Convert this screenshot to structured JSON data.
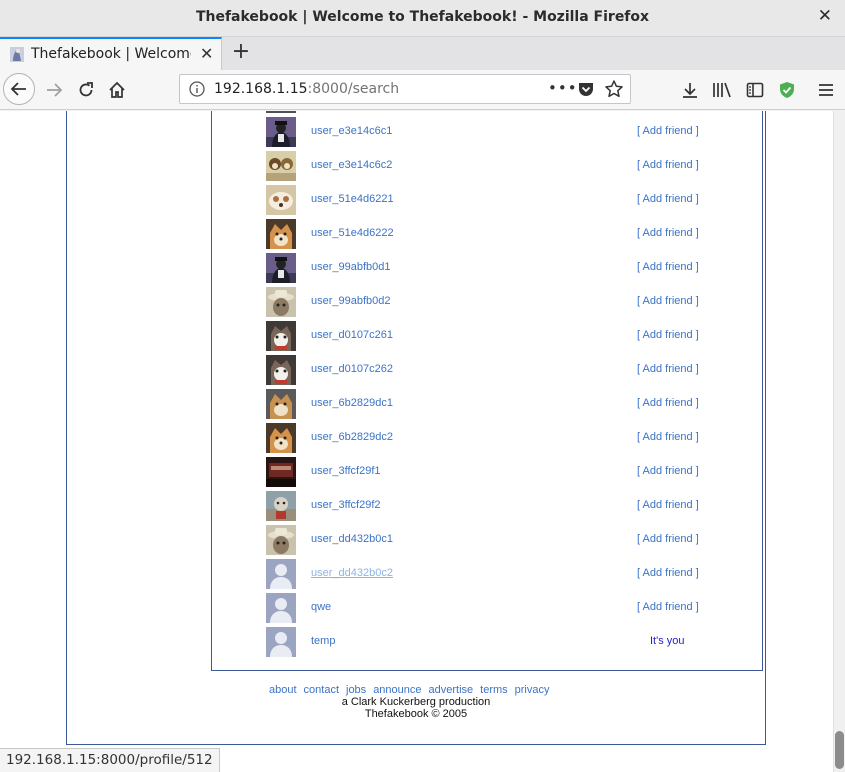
{
  "window": {
    "title": "Thefakebook | Welcome to Thefakebook! - Mozilla Firefox",
    "close_glyph": "✕"
  },
  "tab": {
    "title": "Thefakebook | Welcome to Thefakebook!",
    "close_glyph": "✕",
    "new_tab_glyph": "+"
  },
  "urlbar": {
    "host": "192.168.1.15",
    "path": ":8000/search",
    "more_glyph": "•••"
  },
  "colors": {
    "link": "#3b73c8",
    "frame_border": "#3b5998",
    "tab_accent": "#0a84ff",
    "self_label": "#1e1ed2",
    "shield": "#4caf50"
  },
  "results": [
    {
      "username": "user_e3e14c6c1",
      "action": "[ Add friend ]",
      "photo": "crow-hat"
    },
    {
      "username": "user_e3e14c6c2",
      "action": "[ Add friend ]",
      "photo": "two-dogs"
    },
    {
      "username": "user_51e4d6221",
      "action": "[ Add friend ]",
      "photo": "toy-dogs"
    },
    {
      "username": "user_51e4d6222",
      "action": "[ Add friend ]",
      "photo": "shiba"
    },
    {
      "username": "user_99abfb0d1",
      "action": "[ Add friend ]",
      "photo": "crow-hat"
    },
    {
      "username": "user_99abfb0d2",
      "action": "[ Add friend ]",
      "photo": "hat-man"
    },
    {
      "username": "user_d0107c261",
      "action": "[ Add friend ]",
      "photo": "husky"
    },
    {
      "username": "user_d0107c262",
      "action": "[ Add friend ]",
      "photo": "husky"
    },
    {
      "username": "user_6b2829dc1",
      "action": "[ Add friend ]",
      "photo": "shiba-grey"
    },
    {
      "username": "user_6b2829dc2",
      "action": "[ Add friend ]",
      "photo": "shiba"
    },
    {
      "username": "user_3ffcf29f1",
      "action": "[ Add friend ]",
      "photo": "dark-room"
    },
    {
      "username": "user_3ffcf29f2",
      "action": "[ Add friend ]",
      "photo": "dog-outdoor"
    },
    {
      "username": "user_dd432b0c1",
      "action": "[ Add friend ]",
      "photo": "hat-man"
    },
    {
      "username": "user_dd432b0c2",
      "action": "[ Add friend ]",
      "photo": "default-avatar",
      "hovered": true
    },
    {
      "username": "qwe",
      "action": "[ Add friend ]",
      "photo": "default-avatar"
    },
    {
      "username": "temp",
      "action": "It's you",
      "photo": "default-avatar",
      "self": true
    }
  ],
  "footer": {
    "links": [
      "about",
      "contact",
      "jobs",
      "announce",
      "advertise",
      "terms",
      "privacy"
    ],
    "credit": "a Clark Kuckerberg production",
    "copyright": "Thefakebook © 2005"
  },
  "status_url": "192.168.1.15:8000/profile/512"
}
